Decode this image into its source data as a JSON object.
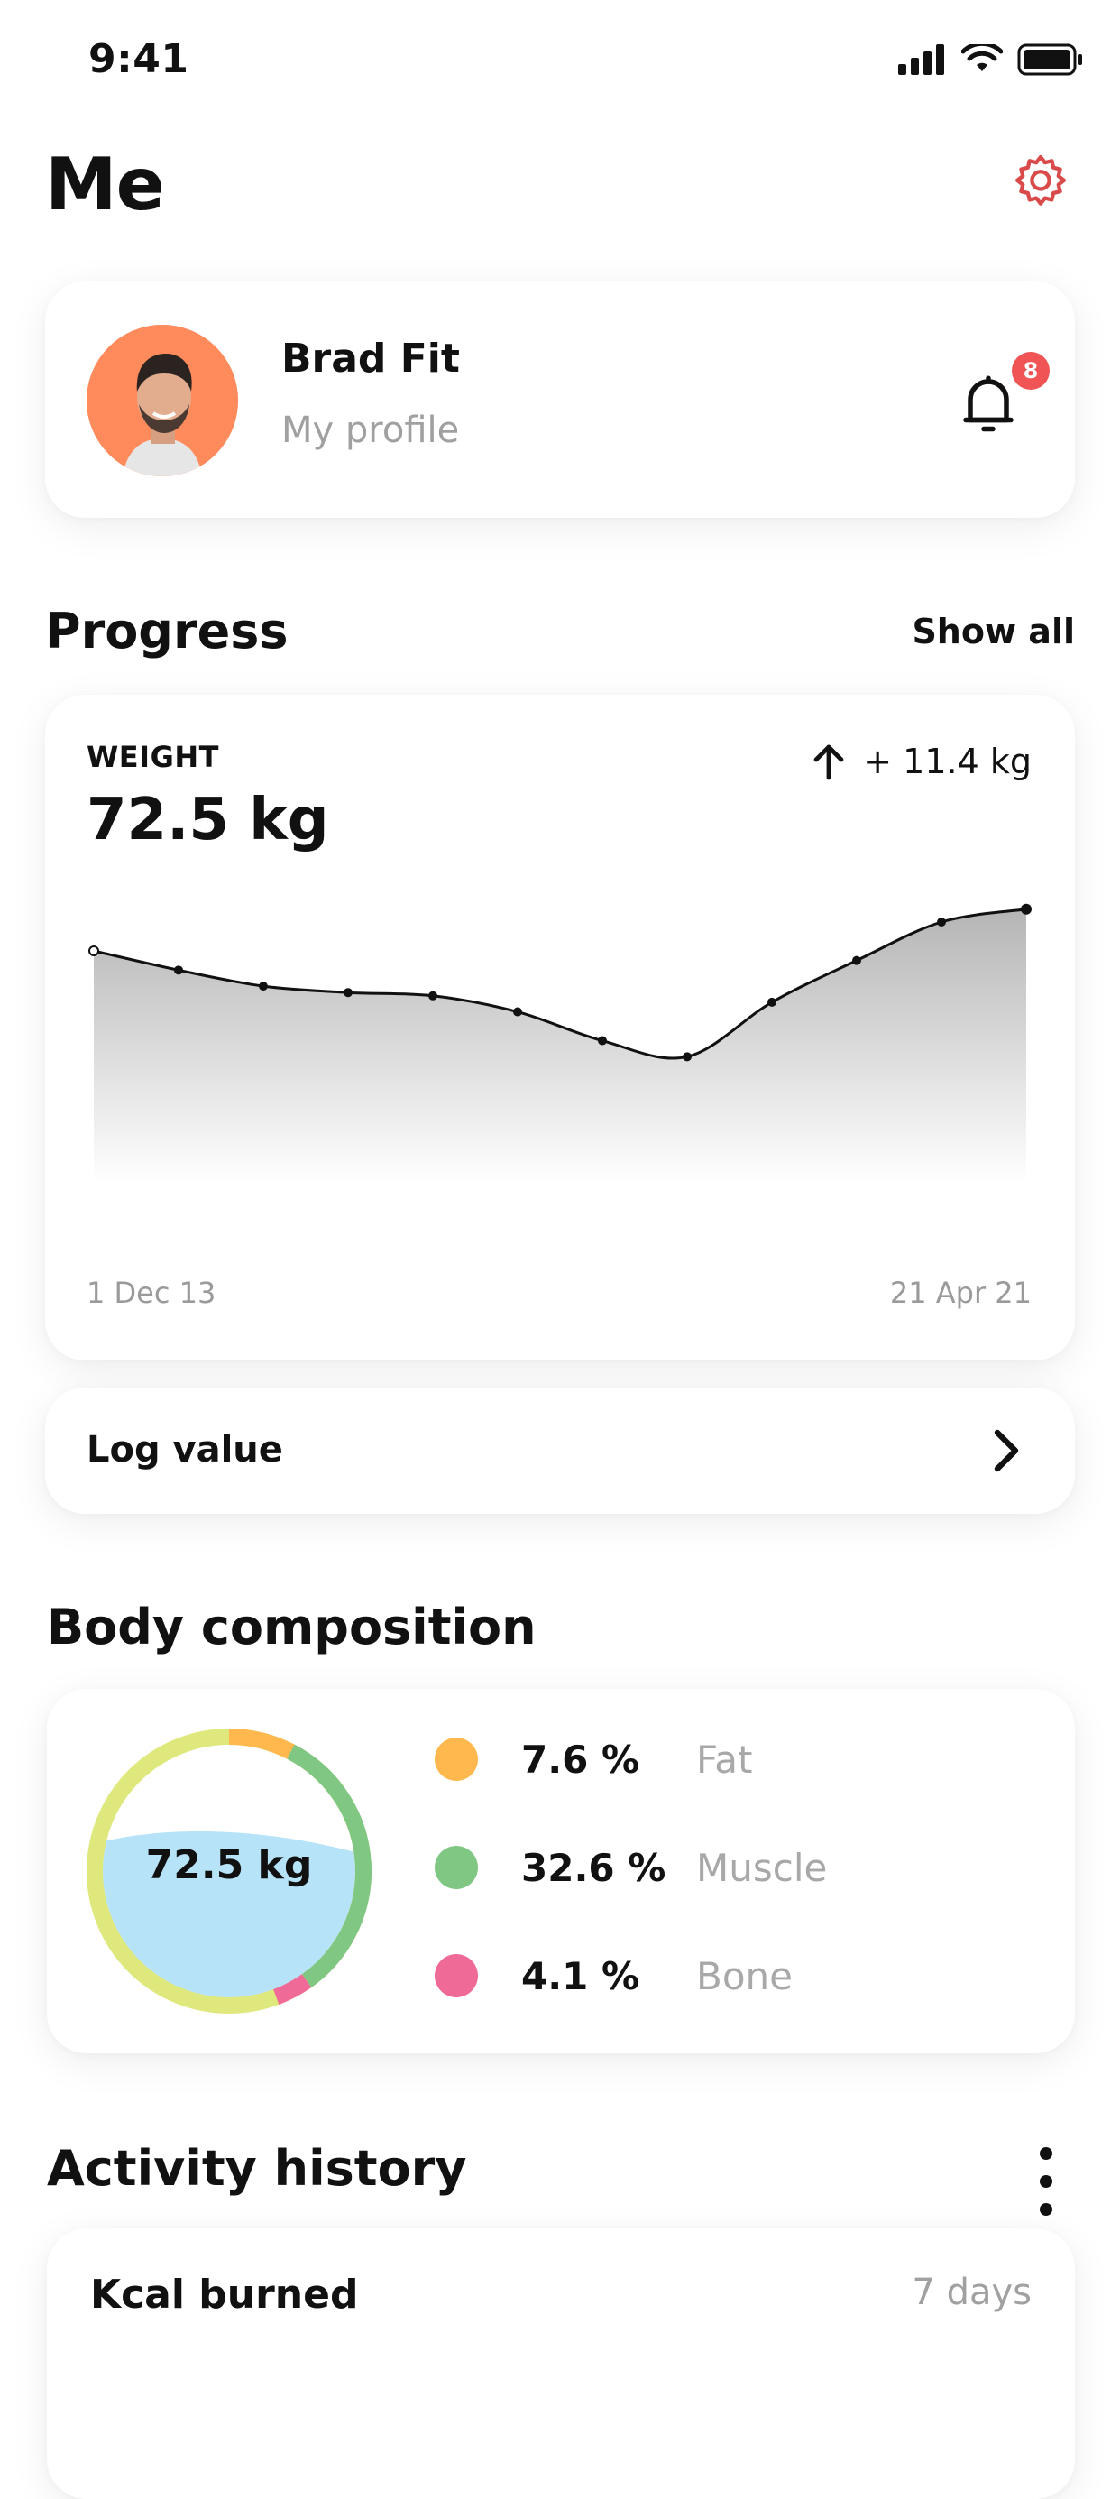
{
  "status_bar": {
    "time": "9:41"
  },
  "header": {
    "title": "Me"
  },
  "profile": {
    "name": "Brad Fit",
    "subtitle": "My profile",
    "notification_count": "8"
  },
  "progress": {
    "title": "Progress",
    "show_all": "Show all"
  },
  "weight": {
    "label": "WEIGHT",
    "value": "72.5 kg",
    "change": "+ 11.4 kg",
    "start_label": "1 Dec 13",
    "end_label": "21 Apr 21"
  },
  "chart_data": {
    "type": "area",
    "title": "WEIGHT",
    "x_labels": [
      "1 Dec 13",
      "21 Apr 21"
    ],
    "values": [
      72.2,
      71.6,
      71.1,
      70.9,
      70.8,
      70.3,
      69.4,
      68.9,
      70.6,
      71.9,
      73.1,
      73.5
    ],
    "grid": true,
    "ylim": [
      65,
      74
    ]
  },
  "log": {
    "label": "Log value"
  },
  "body_composition": {
    "title": "Body composition",
    "total": "72.5 kg",
    "water_level": 0.62,
    "items": [
      {
        "value": "7.6 %",
        "label": "Fat",
        "color": "#ffb84d",
        "share": 7.6
      },
      {
        "value": "32.6 %",
        "label": "Muscle",
        "color": "#80c783",
        "share": 32.6
      },
      {
        "value": "4.1 %",
        "label": "Bone",
        "color": "#ef6a96",
        "share": 4.1
      }
    ],
    "remainder_color": "#dfe87c",
    "water_color": "#b6e3f7"
  },
  "activity": {
    "title": "Activity history",
    "card_label": "Kcal burned",
    "range": "7 days"
  }
}
